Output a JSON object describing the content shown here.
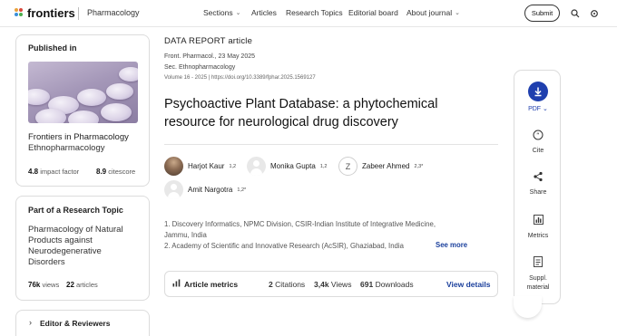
{
  "header": {
    "logo": "frontiers",
    "journal": "Pharmacology",
    "nav": [
      "Sections",
      "Articles",
      "Research Topics",
      "Editorial board",
      "About journal"
    ],
    "submit_label": "Submit",
    "icons": [
      "search-icon",
      "settings-icon",
      "user-icon"
    ]
  },
  "published_in": {
    "heading": "Published in",
    "journal": "Frontiers in Pharmacology",
    "section": "Ethnopharmacology",
    "impact_value": "4.8",
    "impact_label": "impact factor",
    "citescore_value": "8.9",
    "citescore_label": "citescore"
  },
  "research_topic": {
    "heading": "Part of a Research Topic",
    "title_lines": [
      "Pharmacology of Natural",
      "Products against",
      "Neurodegenerative",
      "Disorders"
    ],
    "views_value": "76k",
    "views_label": "views",
    "articles_value": "22",
    "articles_label": "articles"
  },
  "editors": {
    "label": "Editor & Reviewers"
  },
  "article": {
    "type": "DATA REPORT article",
    "journal_date": "Front. Pharmacol., 23 May 2025",
    "section": "Sec. Ethnopharmacology",
    "volume_doi": "Volume 16 - 2025 | https://doi.org/10.3389/fphar.2025.1569127",
    "title_lines": [
      "Psychoactive Plant Database: a phytochemical",
      "resource for neurological drug discovery"
    ],
    "authors": [
      {
        "name": "Harjot Kaur",
        "sup": "1,2"
      },
      {
        "name": "Monika Gupta",
        "sup": "1,2"
      },
      {
        "name": "Zabeer Ahmed",
        "sup": "2,3*",
        "initial": "Z"
      },
      {
        "name": "Amit Nargotra",
        "sup": "1,2*"
      }
    ],
    "affiliations": [
      "1. Discovery Informatics, NPMC Division, CSIR-Indian Institute of Integrative Medicine,",
      "Jammu, India",
      "2. Academy of Scientific and Innovative Research (AcSIR), Ghaziabad, India"
    ],
    "see_more": "See more"
  },
  "metrics": {
    "label": "Article metrics",
    "citations_value": "2",
    "citations_label": "Citations",
    "views_value": "3,4k",
    "views_label": "Views",
    "downloads_value": "691",
    "downloads_label": "Downloads",
    "view_details": "View details"
  },
  "actions": {
    "pdf": "PDF",
    "cite": "Cite",
    "share": "Share",
    "metrics": "Metrics",
    "suppl_line1": "Suppl.",
    "suppl_line2": "material"
  },
  "colors": {
    "accent": "#1f3fae",
    "link": "#1a3f9c",
    "border": "#dcdcdc"
  }
}
